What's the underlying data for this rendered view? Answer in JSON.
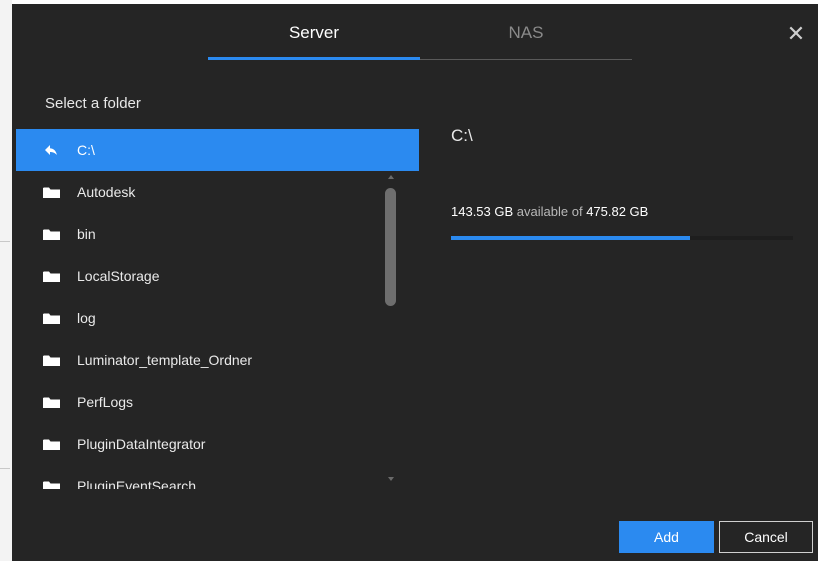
{
  "tabs": {
    "server": "Server",
    "nas": "NAS",
    "active": "Server"
  },
  "close_icon": "close-icon",
  "folder_panel": {
    "label": "Select a folder",
    "current": "C:\\",
    "folders": [
      "Autodesk",
      "bin",
      "LocalStorage",
      "log",
      "Luminator_template_Ordner",
      "PerfLogs",
      "PluginDataIntegrator",
      "PluginEventSearch"
    ]
  },
  "drive": {
    "title": "C:\\",
    "available": "143.53 GB",
    "available_suffix": "available of",
    "total": "475.82 GB",
    "used_fraction": 0.698
  },
  "buttons": {
    "add": "Add",
    "cancel": "Cancel"
  },
  "colors": {
    "accent": "#2b8af0",
    "background": "#252525",
    "text": "#e6e6e6"
  }
}
